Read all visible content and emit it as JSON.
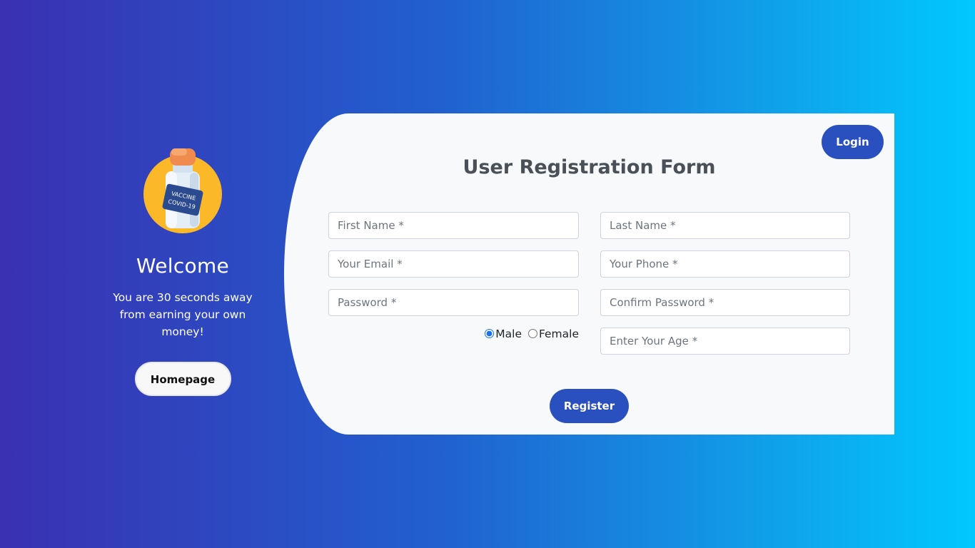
{
  "welcome_panel": {
    "icon": "vaccine-bottle-icon",
    "icon_label_line1": "VACCINE",
    "icon_label_line2": "COVID-19",
    "title": "Welcome",
    "tagline": "You are 30 seconds away from earning your own money!",
    "homepage_label": "Homepage"
  },
  "form": {
    "login_label": "Login",
    "title": "User Registration Form",
    "fields": {
      "first_name": {
        "placeholder": "First Name *",
        "value": ""
      },
      "last_name": {
        "placeholder": "Last Name *",
        "value": ""
      },
      "email": {
        "placeholder": "Your Email *",
        "value": ""
      },
      "phone": {
        "placeholder": "Your Phone *",
        "value": ""
      },
      "password": {
        "placeholder": "Password *",
        "value": ""
      },
      "confirm_password": {
        "placeholder": "Confirm Password *",
        "value": ""
      },
      "age": {
        "placeholder": "Enter Your Age *",
        "value": ""
      }
    },
    "gender": {
      "options": [
        "Male",
        "Female"
      ],
      "selected": "Male"
    },
    "register_label": "Register"
  },
  "colors": {
    "gradient_start": "#3a30b2",
    "gradient_end": "#00c8ff",
    "card_background": "#f8f9fb",
    "button_primary": "#2a4fbf",
    "title_text": "#495057",
    "icon_circle": "#fbb829"
  }
}
